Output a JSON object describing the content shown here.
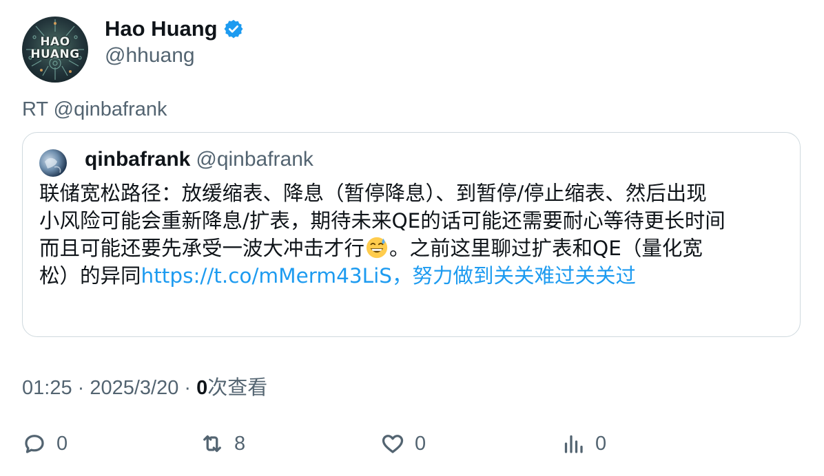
{
  "author": {
    "display_name": "Hao Huang",
    "handle": "@hhuang",
    "avatar_text_line1": "HAO",
    "avatar_text_line2": "HUANG",
    "verified_icon": "verified-badge-icon"
  },
  "retweet_text": "RT @qinbafrank",
  "quoted_tweet": {
    "display_name": "qinbafrank",
    "handle": "@qinbafrank",
    "line1": "联储宽松路径：放缓缩表、降息（暂停降息）、到暂停/停止缩表、然后出现",
    "line2": "小风险可能会重新降息/扩表，期待未来QE的话可能还需要耐心等待更长时间",
    "line3_pre": "而且可能还要先承受一波大冲击才行",
    "emoji": "grinning-face-with-sweat",
    "line3_post": "。之前这里聊过扩表和QE（量化宽",
    "line4_pre": "松）的异同",
    "link_text": "https://t.co/mMerm43LiS，努力做到关关难过关关过"
  },
  "meta": {
    "time": "01:25",
    "sep1": " · ",
    "date": "2025/3/20",
    "sep2": " · ",
    "views_count": "0",
    "views_label": "次查看"
  },
  "actions": {
    "replies": "0",
    "retweets": "8",
    "likes": "0",
    "views": "0"
  },
  "colors": {
    "text_primary": "#0f1419",
    "text_secondary": "#536471",
    "link": "#1d9bf0",
    "border": "#cfd9de",
    "verified": "#1d9bf0"
  }
}
